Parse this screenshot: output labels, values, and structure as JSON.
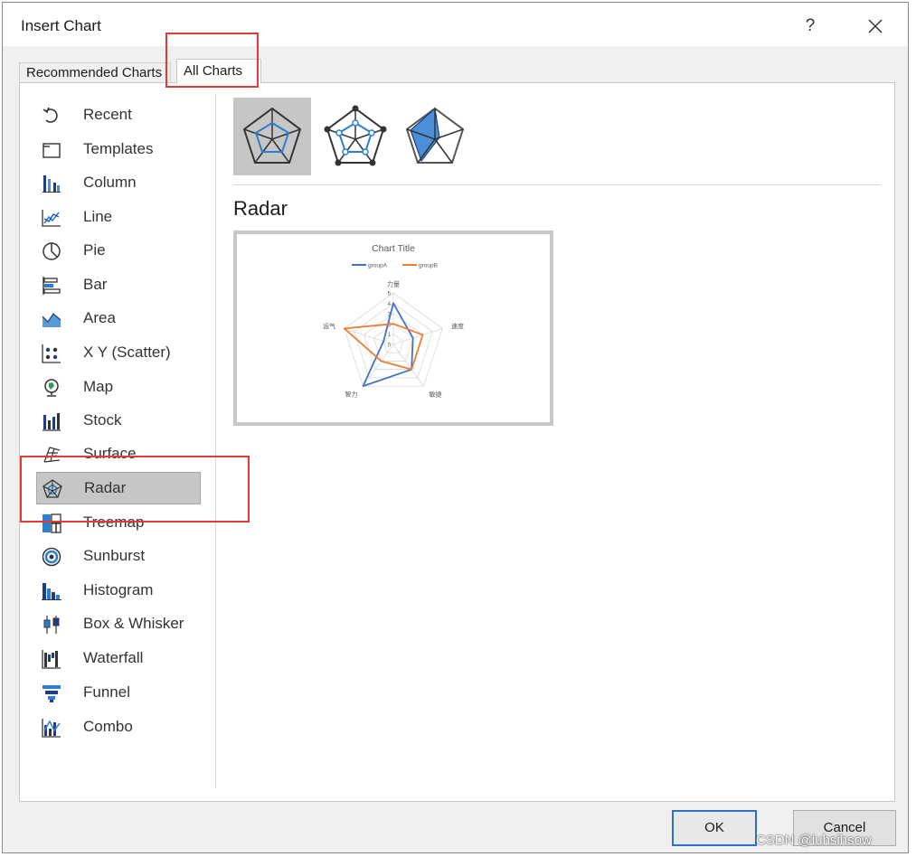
{
  "dialog": {
    "title": "Insert Chart",
    "help_label": "?",
    "tabs": [
      {
        "label": "Recommended Charts"
      },
      {
        "label": "All Charts"
      }
    ]
  },
  "sidebar": {
    "items": [
      {
        "label": "Recent",
        "icon": "recent-icon"
      },
      {
        "label": "Templates",
        "icon": "templates-icon"
      },
      {
        "label": "Column",
        "icon": "column-chart-icon"
      },
      {
        "label": "Line",
        "icon": "line-chart-icon"
      },
      {
        "label": "Pie",
        "icon": "pie-chart-icon"
      },
      {
        "label": "Bar",
        "icon": "bar-chart-icon"
      },
      {
        "label": "Area",
        "icon": "area-chart-icon"
      },
      {
        "label": "X Y (Scatter)",
        "icon": "scatter-chart-icon"
      },
      {
        "label": "Map",
        "icon": "map-chart-icon"
      },
      {
        "label": "Stock",
        "icon": "stock-chart-icon"
      },
      {
        "label": "Surface",
        "icon": "surface-chart-icon"
      },
      {
        "label": "Radar",
        "icon": "radar-chart-icon",
        "selected": true
      },
      {
        "label": "Treemap",
        "icon": "treemap-chart-icon"
      },
      {
        "label": "Sunburst",
        "icon": "sunburst-chart-icon"
      },
      {
        "label": "Histogram",
        "icon": "histogram-chart-icon"
      },
      {
        "label": "Box & Whisker",
        "icon": "box-whisker-chart-icon"
      },
      {
        "label": "Waterfall",
        "icon": "waterfall-chart-icon"
      },
      {
        "label": "Funnel",
        "icon": "funnel-chart-icon"
      },
      {
        "label": "Combo",
        "icon": "combo-chart-icon"
      }
    ]
  },
  "subtypes": [
    {
      "icon": "radar-icon",
      "selected": true
    },
    {
      "icon": "radar-with-markers-icon"
    },
    {
      "icon": "filled-radar-icon"
    }
  ],
  "preview": {
    "heading": "Radar"
  },
  "chart_data": {
    "type": "radar",
    "title": "Chart Title",
    "legend_position": "top",
    "categories": [
      "力量",
      "速度",
      "敏捷",
      "智力",
      "运气"
    ],
    "ticks": [
      "0",
      "1",
      "2",
      "3",
      "4",
      "5"
    ],
    "rlim": [
      0,
      5
    ],
    "series": [
      {
        "name": "groupA",
        "color": "#4472c4",
        "values": [
          4,
          2,
          3,
          5,
          1
        ]
      },
      {
        "name": "groupB",
        "color": "#ed7d31",
        "values": [
          2,
          3,
          3,
          2,
          5
        ]
      }
    ]
  },
  "footer": {
    "ok_label": "OK",
    "cancel_label": "Cancel"
  },
  "watermark": "CSDN @iuhsihsow",
  "colors": {
    "accent": "#2b6fcf",
    "highlight": "#e53935",
    "selected_bg": "#c6c6c6"
  }
}
